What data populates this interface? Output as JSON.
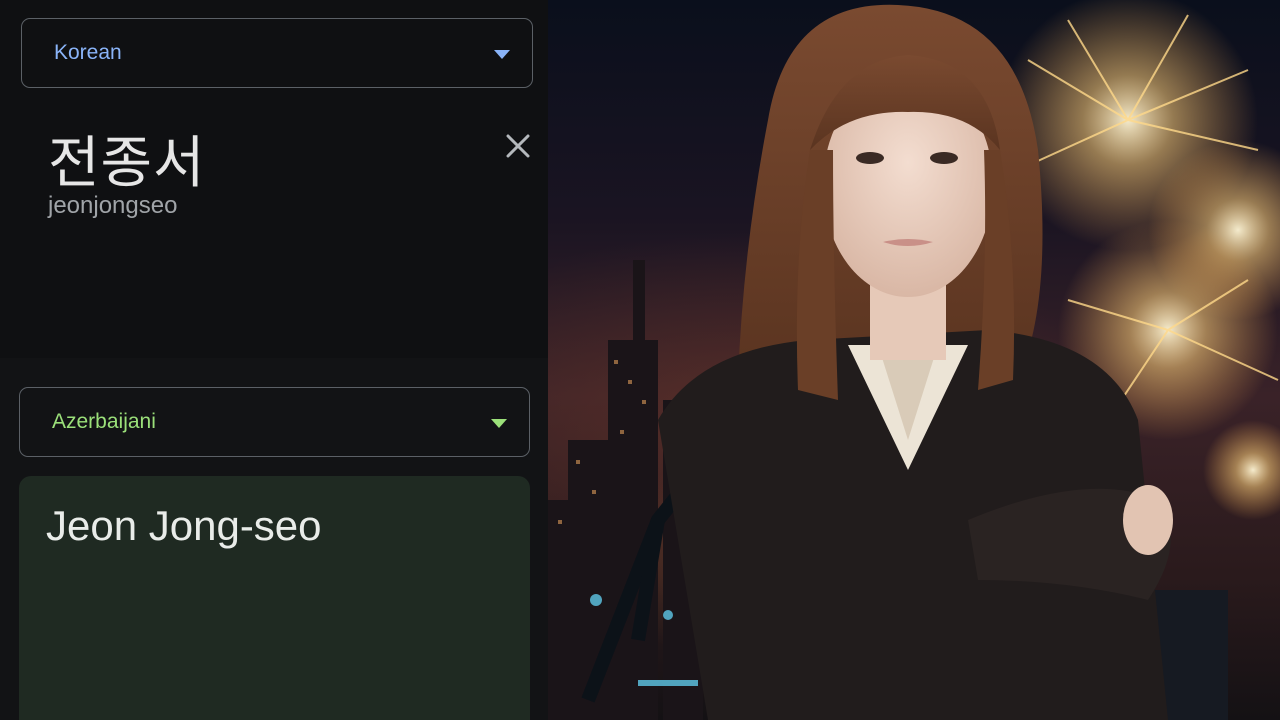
{
  "translator": {
    "source_language": "Korean",
    "source_text": "전종서",
    "romanization": "jeonjongseo",
    "target_language": "Azerbaijani",
    "translated_text": "Jeon Jong-seo"
  },
  "icons": {
    "clear": "close-icon",
    "dropdown": "caret-down-icon"
  },
  "colors": {
    "source_accent": "#8ab4f8",
    "target_accent": "#9be07a",
    "result_background": "#1f2a22"
  }
}
